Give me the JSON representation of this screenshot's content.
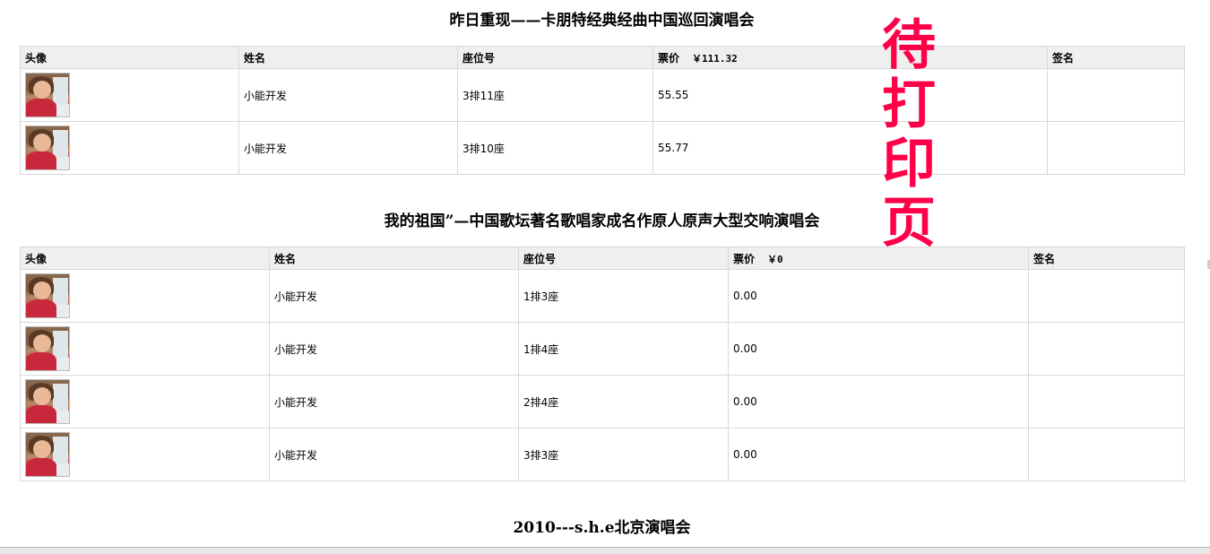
{
  "stamp": [
    "待",
    "打",
    "印",
    "页"
  ],
  "columns": {
    "avatar": "头像",
    "name": "姓名",
    "seat": "座位号",
    "price": "票价",
    "signature": "签名"
  },
  "concerts": [
    {
      "title": "昨日重现——卡朋特经典经曲中国巡回演唱会",
      "total_price": "￥111.32",
      "rows": [
        {
          "name": "小能开发",
          "seat": "3排11座",
          "price": "55.55",
          "signature": ""
        },
        {
          "name": "小能开发",
          "seat": "3排10座",
          "price": "55.77",
          "signature": ""
        }
      ]
    },
    {
      "title": "我的祖国”—中国歌坛著名歌唱家成名作原人原声大型交响演唱会",
      "total_price": "￥0",
      "rows": [
        {
          "name": "小能开发",
          "seat": "1排3座",
          "price": "0.00",
          "signature": ""
        },
        {
          "name": "小能开发",
          "seat": "1排4座",
          "price": "0.00",
          "signature": ""
        },
        {
          "name": "小能开发",
          "seat": "2排4座",
          "price": "0.00",
          "signature": ""
        },
        {
          "name": "小能开发",
          "seat": "3排3座",
          "price": "0.00",
          "signature": ""
        }
      ]
    },
    {
      "title": "2010---s.h.e北京演唱会",
      "total_price": "",
      "rows": []
    }
  ]
}
